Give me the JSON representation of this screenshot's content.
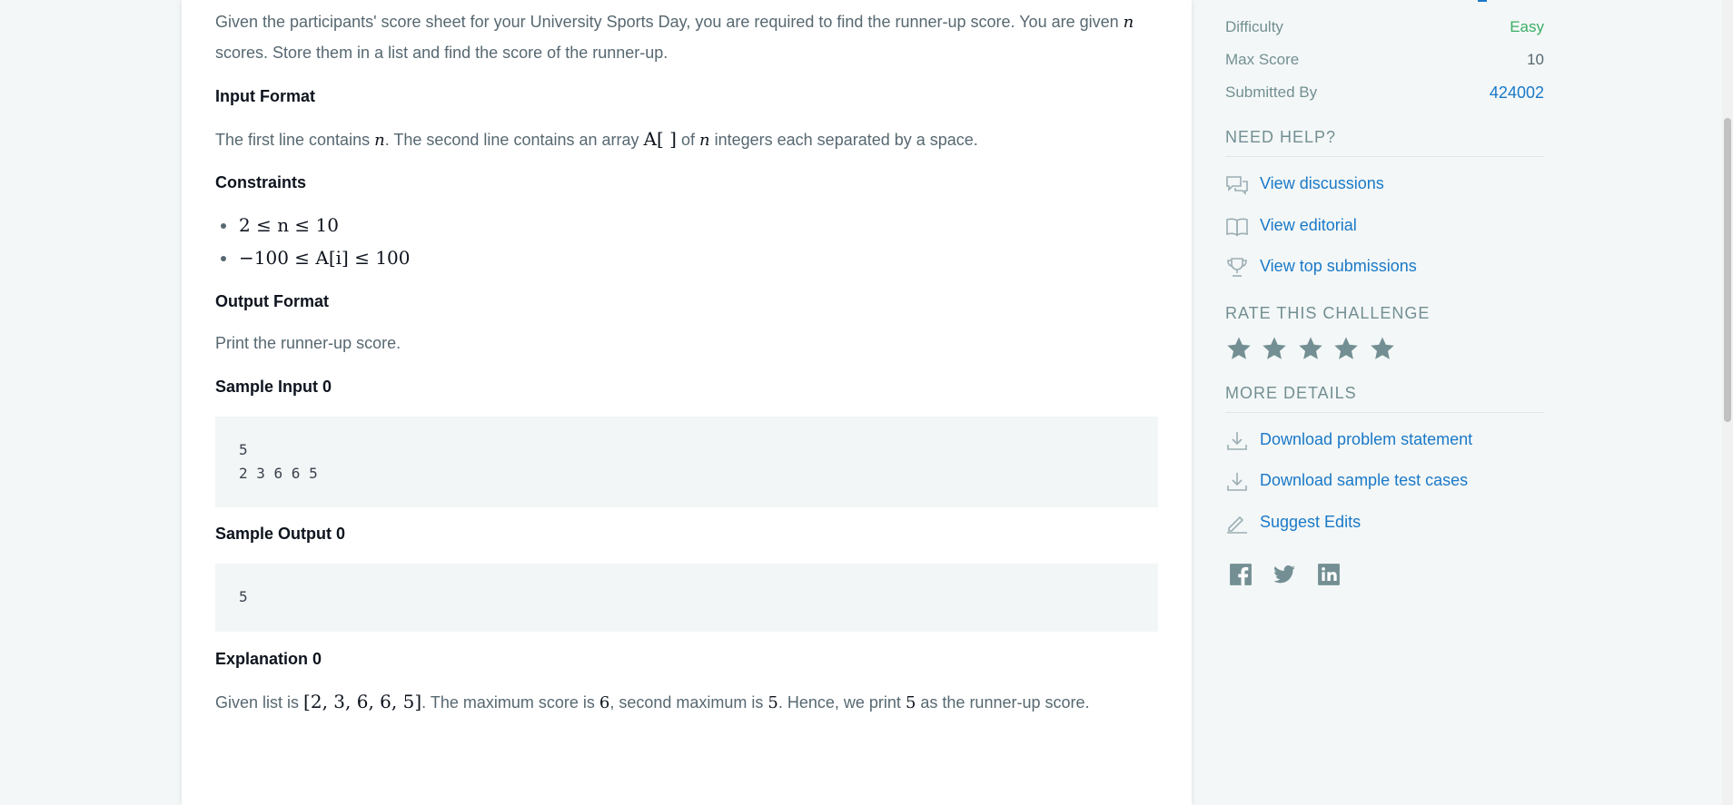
{
  "problem": {
    "intro_line1": "Given the participants' score sheet for your University Sports Day, you are required to find the runner-up score. You are given",
    "intro_var": "n",
    "intro_line2": "scores. Store them in a list and find the score of the runner-up.",
    "input_format": {
      "heading": "Input Format",
      "part1": "The first line contains",
      "var1": "n",
      "part2": ". The second line contains an array",
      "array": "A[ ]",
      "part3": "of",
      "var2": "n",
      "part4": "integers each separated by a space."
    },
    "constraints": {
      "heading": "Constraints",
      "items": [
        "2 ≤ n ≤ 10",
        "−100 ≤ A[i] ≤ 100"
      ]
    },
    "output_format": {
      "heading": "Output Format",
      "text": "Print the runner-up score."
    },
    "sample_input": {
      "heading": "Sample Input 0",
      "lines": [
        "5",
        "2 3 6 6 5"
      ]
    },
    "sample_output": {
      "heading": "Sample Output 0",
      "lines": [
        "5"
      ]
    },
    "explanation": {
      "heading": "Explanation 0",
      "part1": "Given list is",
      "list": "[2, 3, 6, 6, 5]",
      "part2": ". The maximum score is",
      "max": "6",
      "part3": ", second maximum is",
      "second": "5",
      "part4": ". Hence, we print",
      "answer": "5",
      "part5": "as the runner-up score."
    }
  },
  "sidebar": {
    "difficulty": {
      "label": "Difficulty",
      "value": "Easy",
      "color": "#3dae66"
    },
    "max_score": {
      "label": "Max Score",
      "value": "10"
    },
    "submitted_by": {
      "label": "Submitted By",
      "value": "424002"
    },
    "need_help": {
      "title": "NEED HELP?",
      "links": [
        {
          "icon": "chat-bubbles-icon",
          "label": "View discussions"
        },
        {
          "icon": "book-icon",
          "label": "View editorial"
        },
        {
          "icon": "trophy-icon",
          "label": "View top submissions"
        }
      ]
    },
    "rate": {
      "title": "RATE THIS CHALLENGE",
      "stars": 5
    },
    "more_details": {
      "title": "MORE DETAILS",
      "links": [
        {
          "icon": "download-icon",
          "label": "Download problem statement"
        },
        {
          "icon": "download-icon",
          "label": "Download sample test cases"
        },
        {
          "icon": "pencil-icon",
          "label": "Suggest Edits"
        }
      ]
    },
    "social": [
      "facebook-icon",
      "twitter-icon",
      "linkedin-icon"
    ]
  }
}
